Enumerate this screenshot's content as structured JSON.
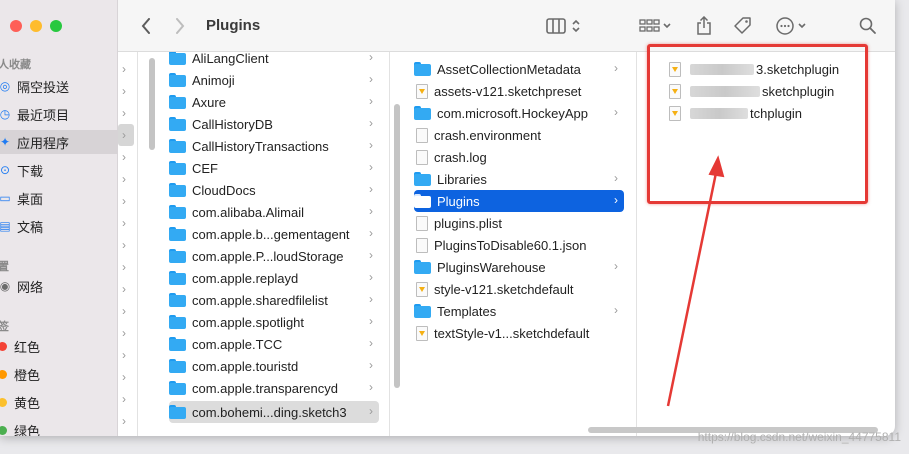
{
  "toolbar": {
    "title": "Plugins",
    "back_icon": "chevron-left-icon",
    "forward_icon": "chevron-right-icon"
  },
  "sidebar": {
    "favorites_header": "人收藏",
    "favorites": [
      {
        "label": "隔空投送",
        "icon": "airdrop-icon"
      },
      {
        "label": "最近项目",
        "icon": "clock-icon"
      },
      {
        "label": "应用程序",
        "icon": "apps-icon"
      },
      {
        "label": "下载",
        "icon": "download-icon"
      },
      {
        "label": "桌面",
        "icon": "desktop-icon"
      },
      {
        "label": "文稿",
        "icon": "document-icon"
      }
    ],
    "locations_header": "置",
    "locations": [
      {
        "label": "网络",
        "icon": "network-icon"
      }
    ],
    "tags_header": "签",
    "tags": [
      {
        "label": "红色",
        "color": "#f44336"
      },
      {
        "label": "橙色",
        "color": "#ff9800"
      },
      {
        "label": "黄色",
        "color": "#fbc02d"
      },
      {
        "label": "绿色",
        "color": "#4caf50"
      }
    ]
  },
  "column1": [
    {
      "name": "AliLangClient"
    },
    {
      "name": "Animoji"
    },
    {
      "name": "Axure"
    },
    {
      "name": "CallHistoryDB"
    },
    {
      "name": "CallHistoryTransactions"
    },
    {
      "name": "CEF"
    },
    {
      "name": "CloudDocs"
    },
    {
      "name": "com.alibaba.Alimail"
    },
    {
      "name": "com.apple.b...gementagent"
    },
    {
      "name": "com.apple.P...loudStorage"
    },
    {
      "name": "com.apple.replayd"
    },
    {
      "name": "com.apple.sharedfilelist"
    },
    {
      "name": "com.apple.spotlight"
    },
    {
      "name": "com.apple.TCC"
    },
    {
      "name": "com.apple.touristd"
    },
    {
      "name": "com.apple.transparencyd"
    },
    {
      "name": "com.bohemi...ding.sketch3"
    }
  ],
  "column2": [
    {
      "name": "AssetCollectionMetadata",
      "kind": "folder",
      "chevron": true
    },
    {
      "name": "assets-v121.sketchpreset",
      "kind": "sketch",
      "chevron": false
    },
    {
      "name": "com.microsoft.HockeyApp",
      "kind": "folder",
      "chevron": true
    },
    {
      "name": "crash.environment",
      "kind": "doc",
      "chevron": false
    },
    {
      "name": "crash.log",
      "kind": "doc",
      "chevron": false
    },
    {
      "name": "Libraries",
      "kind": "folder",
      "chevron": true
    },
    {
      "name": "Plugins",
      "kind": "folder",
      "chevron": true
    },
    {
      "name": "plugins.plist",
      "kind": "doc",
      "chevron": false
    },
    {
      "name": "PluginsToDisable60.1.json",
      "kind": "doc",
      "chevron": false
    },
    {
      "name": "PluginsWarehouse",
      "kind": "folder",
      "chevron": true
    },
    {
      "name": "style-v121.sketchdefault",
      "kind": "sketch",
      "chevron": false
    },
    {
      "name": "Templates",
      "kind": "folder",
      "chevron": true
    },
    {
      "name": "textStyle-v1...sketchdefault",
      "kind": "sketch",
      "chevron": false
    }
  ],
  "column3": [
    {
      "visible_text": "3.sketchplugin"
    },
    {
      "visible_text": "sketchplugin"
    },
    {
      "visible_text": "tchplugin"
    }
  ],
  "chevron_char": "›",
  "watermark": "https://blog.csdn.net/weixin_44775811"
}
